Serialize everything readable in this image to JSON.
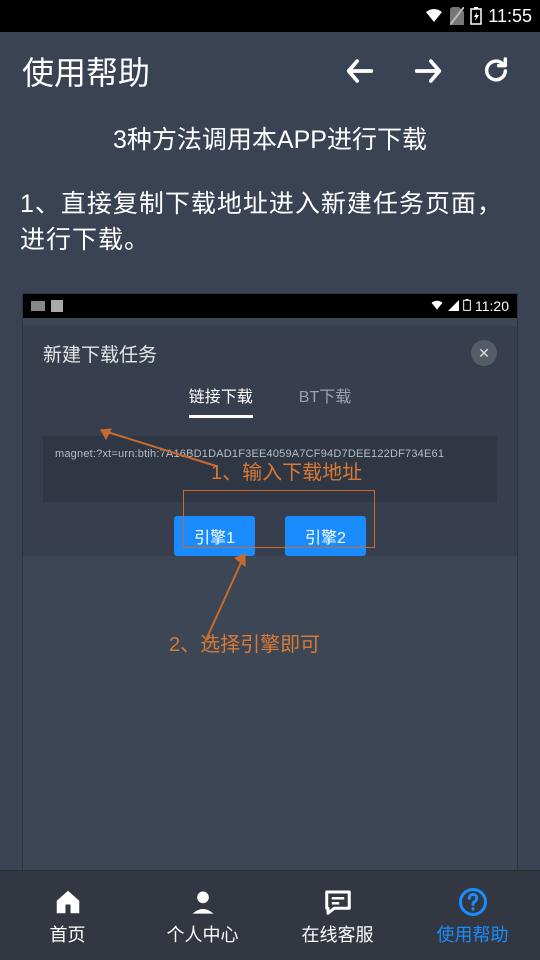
{
  "statusbar": {
    "time": "11:55"
  },
  "appbar": {
    "title": "使用帮助"
  },
  "content": {
    "section_title": "3种方法调用本APP进行下载",
    "step1": "1、直接复制下载地址进入新建任务页面，进行下载。"
  },
  "screenshot": {
    "sb_time": "11:20",
    "card_title": "新建下载任务",
    "tabs": {
      "link": "链接下载",
      "bt": "BT下载"
    },
    "input_value": "magnet:?xt=urn:btih:7A16BD1DAD1F3EE4059A7CF94D7DEE122DF734E61",
    "engine1": "引擎1",
    "engine2": "引擎2",
    "anno1": "1、输入下载地址",
    "anno2": "2、选择引擎即可"
  },
  "bottomnav": {
    "home": "首页",
    "profile": "个人中心",
    "support": "在线客服",
    "help": "使用帮助"
  }
}
